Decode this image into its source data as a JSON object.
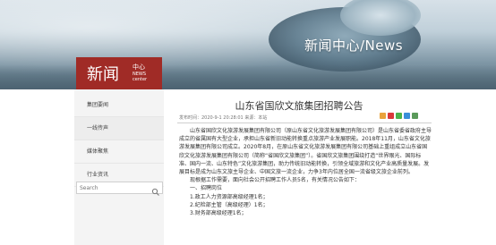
{
  "banner": {
    "title": "新闻中心/News"
  },
  "badge": {
    "main": "新闻",
    "cn": "中心",
    "en": "NEWS center"
  },
  "sidebar": {
    "items": [
      {
        "label": "集团要闻"
      },
      {
        "label": "一线传声"
      },
      {
        "label": "媒体聚焦"
      },
      {
        "label": "行业资讯"
      }
    ],
    "search_placeholder": "Search"
  },
  "article": {
    "title": "山东省国欣文旅集团招聘公告",
    "meta": "发布时间：2020-9-1 20:28:01  来源：本站",
    "paragraphs": [
      "山东省国欣文化旅游发展集团有限公司（原山东省文化旅游发展集团有限公司）是山东省委省政府主导成立的省属国有大型企业，承担山东省新旧动能转换重点旅游产业发展职能。2018年11月，山东省文化旅游发展集团有限公司成立。2020年8月，在原山东省文化旅游发展集团有限公司基础上重组成立山东省国欣文化旅游发展集团有限公司（简称“省国欣文旅集团”）。省国欣文旅集团围绕打造“世界眼光、国际标准、国内一流、山东特色”文化旅游集团，助力传统旧动能转换，引领全域旅游和文化产业高质量发展。发展目标是成为山东文旅主导企业、中国文旅一流企业，力争3年内位居全国一流省级文旅企业前列。",
      "现根据工作需要，面向社会公开招聘工作人员5名，有关情况公告如下："
    ],
    "section_heading": "一、招聘岗位",
    "items": [
      "1.政工人力资源部高级经理1名；",
      "2.纪检部主管（高级经理）1名；",
      "3.财务部高级经理1名；"
    ]
  },
  "colors": {
    "badge_red": "#a02b26",
    "sidebar_bg": "#f4f4f4"
  },
  "icons": [
    "search-icon",
    "share-qzone-icon",
    "share-weibo-icon",
    "share-wechat-icon",
    "share-qq-icon",
    "share-more-icon"
  ]
}
